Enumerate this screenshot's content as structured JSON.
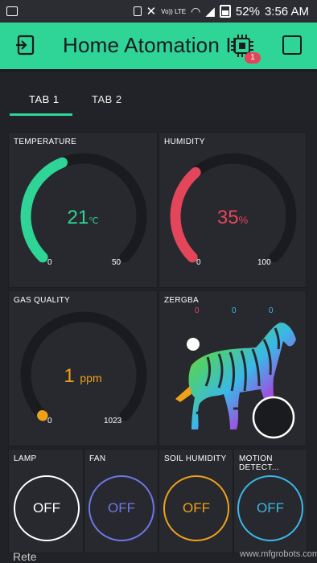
{
  "status_bar": {
    "battery": "52%",
    "time": "3:56 AM",
    "network": "Vo)) LTE"
  },
  "app_bar": {
    "title": "Home Atomation II",
    "device_badge": "1",
    "bg_color": "#2fd497"
  },
  "tabs": [
    {
      "label": "TAB 1",
      "active": true
    },
    {
      "label": "TAB 2",
      "active": false
    }
  ],
  "widgets": {
    "temperature": {
      "label": "TEMPERATURE",
      "value": "21",
      "unit": "℃",
      "min": "0",
      "max": "50",
      "fraction": 0.42,
      "color": "#2fd497"
    },
    "humidity": {
      "label": "HUMIDITY",
      "value": "35",
      "unit": "%",
      "min": "0",
      "max": "100",
      "fraction": 0.35,
      "color": "#e3465b"
    },
    "gas": {
      "label": "GAS QUALITY",
      "value": "1",
      "unit": "ppm",
      "min": "0",
      "max": "1023",
      "fraction": 0.001,
      "color": "#f0a11a"
    },
    "zergba": {
      "label": "ZERGBA",
      "r": "0",
      "g": "0",
      "b": "0"
    },
    "lamp": {
      "label": "LAMP",
      "state": "OFF",
      "color": "#ffffff"
    },
    "fan": {
      "label": "FAN",
      "state": "OFF",
      "color": "#6f76e8"
    },
    "soil": {
      "label": "SOIL HUMIDITY",
      "state": "OFF",
      "color": "#f0a11a"
    },
    "motion": {
      "label": "MOTION DETECT...",
      "state": "OFF",
      "color": "#3ab8e8"
    }
  },
  "footer": {
    "peek_text": "Rete",
    "watermark": "www.mfgrobots.com"
  }
}
